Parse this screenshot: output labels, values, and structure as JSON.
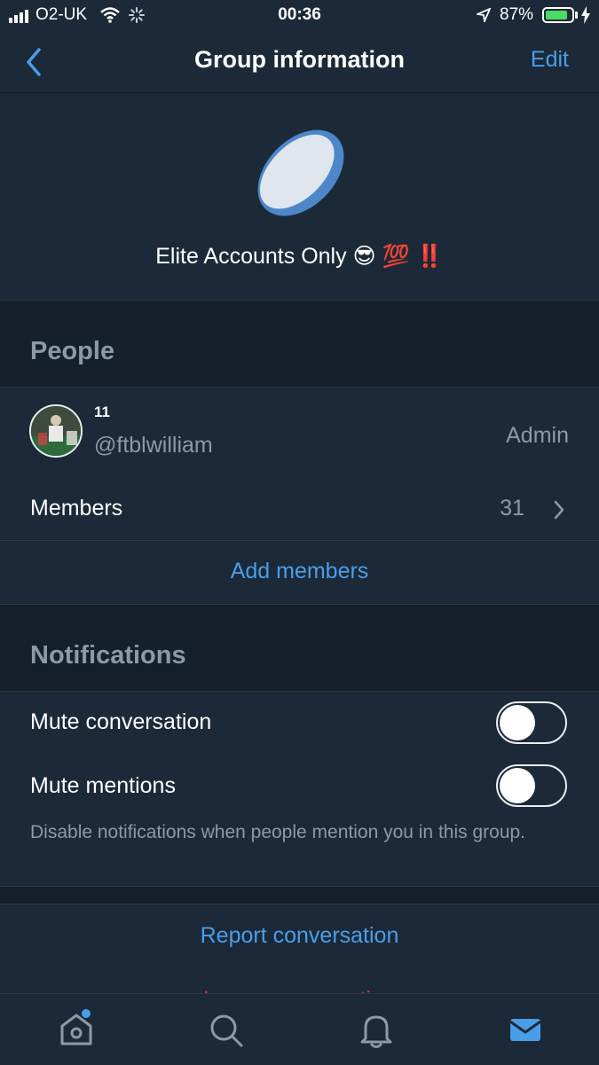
{
  "status_bar": {
    "carrier": "O2-UK",
    "time": "00:36",
    "battery_percent": "87%",
    "battery_level": 0.87
  },
  "nav": {
    "title": "Group information",
    "edit_label": "Edit"
  },
  "group": {
    "name": "Elite Accounts Only 😎 💯 ‼️"
  },
  "people": {
    "section_title": "People",
    "admin_user": {
      "display_name": "11",
      "handle": "@ftblwilliam",
      "role": "Admin"
    },
    "members_label": "Members",
    "members_count": "31",
    "add_members_label": "Add members"
  },
  "notifications": {
    "section_title": "Notifications",
    "mute_conversation_label": "Mute conversation",
    "mute_mentions_label": "Mute mentions",
    "mute_mentions_help": "Disable notifications when people mention you in this group.",
    "mute_conversation_on": false,
    "mute_mentions_on": false
  },
  "actions": {
    "report_label": "Report conversation",
    "leave_label": "Leave conversation"
  },
  "tabbar": {
    "tabs": [
      "home-icon",
      "search-icon",
      "bell-icon",
      "mail-icon"
    ],
    "active": "mail-icon"
  },
  "colors": {
    "accent": "#4a9ee8",
    "background": "#15202b",
    "surface": "#1c2938",
    "danger": "#e0245e",
    "battery": "#4cd964"
  }
}
